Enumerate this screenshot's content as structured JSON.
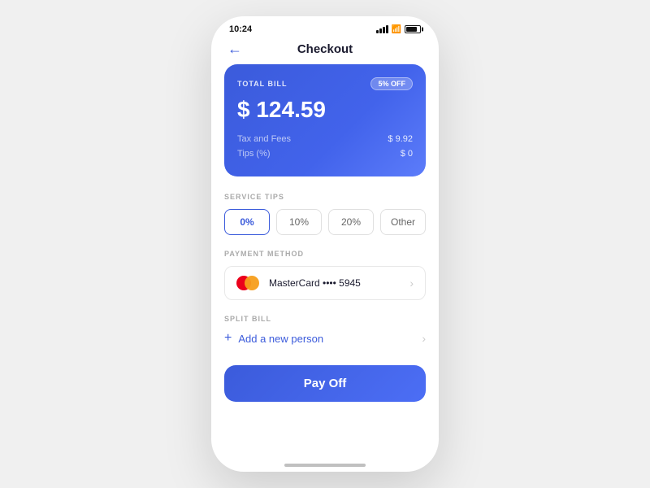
{
  "status_bar": {
    "time": "10:24"
  },
  "header": {
    "title": "Checkout",
    "back_label": "←"
  },
  "bill_card": {
    "label": "TOTAL BILL",
    "discount_badge": "5% OFF",
    "total_amount": "$ 124.59",
    "tax_label": "Tax and Fees",
    "tax_value": "$ 9.92",
    "tips_label": "Tips (%)",
    "tips_value": "$ 0"
  },
  "service_tips": {
    "section_label": "SERVICE TIPS",
    "options": [
      "0%",
      "10%",
      "20%",
      "Other"
    ],
    "active_index": 0
  },
  "payment_method": {
    "section_label": "PAYMENT METHOD",
    "card_name": "MasterCard •••• 5945"
  },
  "split_bill": {
    "section_label": "SPLIT BILL",
    "add_person_label": "Add a new person"
  },
  "pay_button": {
    "label": "Pay Off"
  }
}
